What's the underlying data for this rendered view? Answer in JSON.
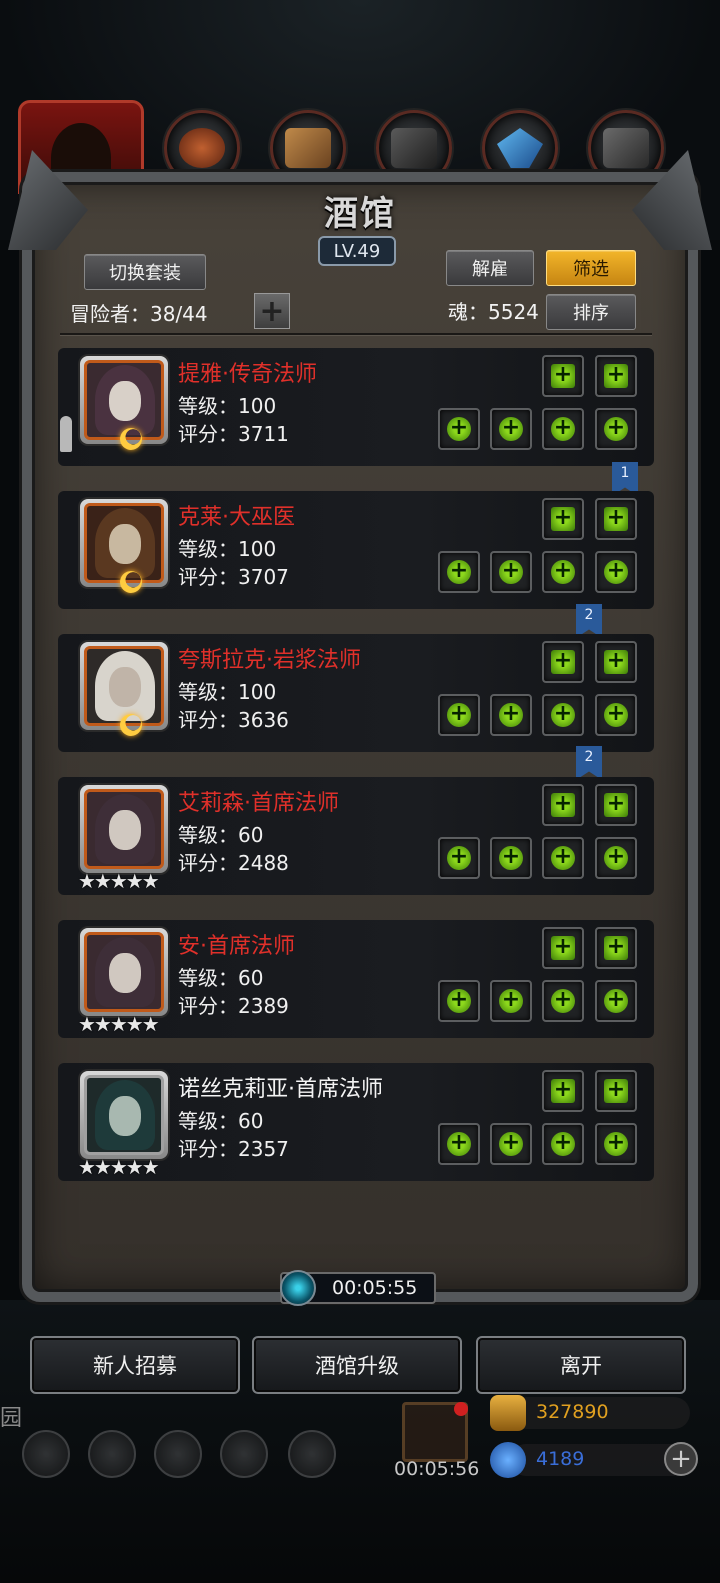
{
  "tavern": {
    "title": "酒馆",
    "level": "LV.49",
    "switch_outfit": "切换套装",
    "dismiss": "解雇",
    "filter": "筛选",
    "sort": "排序",
    "adventurers_label": "冒险者：38/44",
    "adventurers_current": 38,
    "adventurers_max": 44,
    "soul_label": "魂：5524",
    "soul_value": 5524
  },
  "heroes": [
    {
      "name": "提雅·传奇法师",
      "level": "等级：100",
      "score": "评分：3711",
      "name_color": "#e0302a",
      "badge": "moon",
      "stars": ""
    },
    {
      "name": "克莱·大巫医",
      "level": "等级：100",
      "score": "评分：3707",
      "name_color": "#e0302a",
      "badge": "moon",
      "stars": ""
    },
    {
      "name": "夸斯拉克·岩浆法师",
      "level": "等级：100",
      "score": "评分：3636",
      "name_color": "#e0302a",
      "badge": "moon",
      "stars": ""
    },
    {
      "name": "艾莉森·首席法师",
      "level": "等级：60",
      "score": "评分：2488",
      "name_color": "#e0302a",
      "badge": "stars",
      "stars": "★★★★★"
    },
    {
      "name": "安·首席法师",
      "level": "等级：60",
      "score": "评分：2389",
      "name_color": "#e0302a",
      "badge": "stars",
      "stars": "★★★★★"
    },
    {
      "name": "诺丝克莉亚·首席法师",
      "level": "等级：60",
      "score": "评分：2357",
      "name_color": "#f4f4f4",
      "badge": "stars",
      "stars": "★★★★★"
    }
  ],
  "ribbons": [
    "1",
    "2",
    "2"
  ],
  "slot_plus": "+",
  "plus_button": "+",
  "timer": "00:05:55",
  "bottom_buttons": {
    "recruit": "新人招募",
    "upgrade": "酒馆升级",
    "leave": "离开"
  },
  "hud": {
    "side_char": "园",
    "gift_timer": "00:05:56",
    "gold": "327890",
    "gems": "4189",
    "add": "+"
  },
  "colors": {
    "name_red": "#e0302a",
    "gold_button": "#e0a020",
    "gold_text": "#e0a020",
    "gem_text": "#3a6ed8",
    "slot_plus_green": "#8cd81c"
  }
}
